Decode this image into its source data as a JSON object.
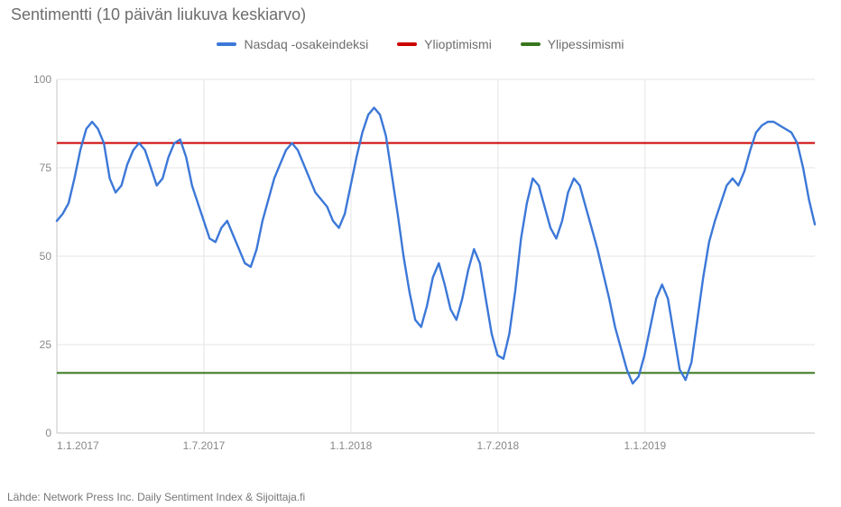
{
  "title": "Sentimentti (10 päivän liukuva keskiarvo)",
  "legend": {
    "nasdaq": "Nasdaq -osakeindeksi",
    "ylioptimismi": "Ylioptimismi",
    "ylipessimismi": "Ylipessimismi"
  },
  "footer": "Lähde: Network Press Inc.  Daily Sentiment Index & Sijoittaja.fi",
  "chart_data": {
    "type": "line",
    "title": "Sentimentti (10 päivän liukuva keskiarvo)",
    "xlabel": "",
    "ylabel": "",
    "ylim": [
      0,
      100
    ],
    "x_ticks": [
      "1.1.2017",
      "1.7.2017",
      "1.1.2018",
      "1.7.2018",
      "1.1.2019"
    ],
    "y_ticks": [
      0,
      25,
      50,
      75,
      100
    ],
    "series": [
      {
        "name": "Nasdaq -osakeindeksi",
        "color": "#3c78d8",
        "x": [
          0,
          1,
          2,
          3,
          4,
          5,
          6,
          7,
          8,
          9,
          10,
          11,
          12,
          13,
          14,
          15,
          16,
          17,
          18,
          19,
          20,
          21,
          22,
          23,
          24,
          25,
          26,
          27,
          28,
          29,
          30,
          31,
          32,
          33,
          34,
          35,
          36,
          37,
          38,
          39,
          40,
          41,
          42,
          43,
          44,
          45,
          46,
          47,
          48,
          49,
          50,
          51,
          52,
          53,
          54,
          55,
          56,
          57,
          58,
          59,
          60,
          61,
          62,
          63,
          64,
          65,
          66,
          67,
          68,
          69,
          70,
          71,
          72,
          73,
          74,
          75,
          76,
          77,
          78,
          79,
          80,
          81,
          82,
          83,
          84,
          85,
          86,
          87,
          88,
          89,
          90,
          91,
          92,
          93,
          94,
          95,
          96,
          97,
          98,
          99,
          100,
          101,
          102,
          103,
          104,
          105,
          106,
          107,
          108,
          109,
          110,
          111,
          112,
          113,
          114,
          115,
          116,
          117,
          118,
          119,
          120,
          121,
          122,
          123,
          124,
          125,
          126,
          127,
          128,
          129
        ],
        "values": [
          60,
          62,
          65,
          72,
          80,
          86,
          88,
          86,
          82,
          72,
          68,
          70,
          76,
          80,
          82,
          80,
          75,
          70,
          72,
          78,
          82,
          83,
          78,
          70,
          65,
          60,
          55,
          54,
          58,
          60,
          56,
          52,
          48,
          47,
          52,
          60,
          66,
          72,
          76,
          80,
          82,
          80,
          76,
          72,
          68,
          66,
          64,
          60,
          58,
          62,
          70,
          78,
          85,
          90,
          92,
          90,
          84,
          73,
          62,
          50,
          40,
          32,
          30,
          36,
          44,
          48,
          42,
          35,
          32,
          38,
          46,
          52,
          48,
          38,
          28,
          22,
          21,
          28,
          40,
          55,
          65,
          72,
          70,
          64,
          58,
          55,
          60,
          68,
          72,
          70,
          64,
          58,
          52,
          45,
          38,
          30,
          24,
          18,
          14,
          16,
          22,
          30,
          38,
          42,
          38,
          28,
          18,
          15,
          20,
          32,
          44,
          54,
          60,
          65,
          70,
          72,
          70,
          74,
          80,
          85,
          87,
          88,
          88,
          87,
          86,
          85,
          82,
          75,
          66,
          59
        ]
      },
      {
        "name": "Ylioptimismi",
        "color": "#cc0000",
        "constant": 82
      },
      {
        "name": "Ylipessimismi",
        "color": "#38761d",
        "constant": 17
      }
    ]
  }
}
